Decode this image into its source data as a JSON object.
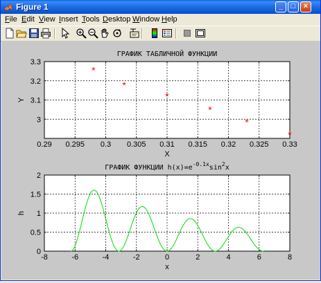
{
  "window": {
    "title": "Figure 1"
  },
  "menus": [
    {
      "label": "File",
      "u": "F",
      "rest": "ile"
    },
    {
      "label": "Edit",
      "u": "E",
      "rest": "dit"
    },
    {
      "label": "View",
      "u": "V",
      "rest": "iew"
    },
    {
      "label": "Insert",
      "u": "I",
      "rest": "nsert"
    },
    {
      "label": "Tools",
      "u": "T",
      "rest": "ools"
    },
    {
      "label": "Desktop",
      "u": "D",
      "rest": "esktop"
    },
    {
      "label": "Window",
      "u": "W",
      "rest": "indow"
    },
    {
      "label": "Help",
      "u": "H",
      "rest": "elp"
    }
  ],
  "toolbar": [
    "new-figure-icon",
    "open-file-icon",
    "save-icon",
    "print-icon",
    "arrow-pointer-icon",
    "zoom-in-icon",
    "zoom-out-icon",
    "pan-hand-icon",
    "rotate-3d-icon",
    "data-cursor-icon",
    "colorbar-icon",
    "legend-icon",
    "hide-plot-tools-icon",
    "show-plot-tools-icon"
  ],
  "chart_data": [
    {
      "type": "scatter",
      "title": "ГРАФИК ТАБЛИЧНОЙ ФУНКЦИИ",
      "xlabel": "X",
      "ylabel": "Y",
      "xlim": [
        0.29,
        0.33
      ],
      "ylim": [
        2.9,
        3.3
      ],
      "xticks": [
        "0.29",
        "0.295",
        "0.3",
        "0.305",
        "0.31",
        "0.315",
        "0.32",
        "0.325",
        "0.33"
      ],
      "yticks": [
        "3",
        "3.1",
        "3.2",
        "3.3"
      ],
      "grid": true,
      "marker": "*",
      "color": "#ff0000",
      "x": [
        0.298,
        0.303,
        0.31,
        0.317,
        0.323,
        0.33
      ],
      "y": [
        3.255,
        3.178,
        3.12,
        3.05,
        2.985,
        2.92
      ]
    },
    {
      "type": "line",
      "title_prefix": "ГРАФИК ФУНКЦИИ    h(x)=e",
      "title_sup1": "-0.1x",
      "title_mid": "sin",
      "title_sup2": "2",
      "title_end": "x",
      "xlabel": "x",
      "ylabel": "h",
      "xlim": [
        -8,
        8
      ],
      "ylim": [
        0,
        2
      ],
      "xticks": [
        "-8",
        "-6",
        "-4",
        "-2",
        "0",
        "2",
        "4",
        "6",
        "8"
      ],
      "yticks": [
        "0",
        "0.5",
        "1",
        "1.5",
        "2"
      ],
      "grid": true,
      "color": "#00dd00",
      "function": "exp(-0.1*x)*sin(x)^2",
      "x_range": [
        -6.28,
        6.28
      ]
    }
  ]
}
